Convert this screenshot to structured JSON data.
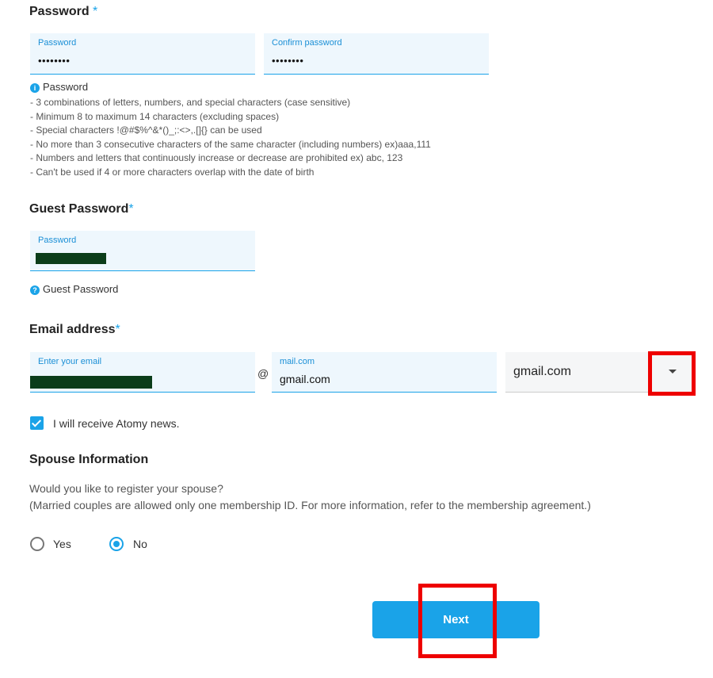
{
  "password_section": {
    "title": "Password",
    "required_mark": "*",
    "password_label": "Password",
    "password_value": "••••••••",
    "confirm_label": "Confirm password",
    "confirm_value": "••••••••",
    "info_title": "Password",
    "rules": [
      "- 3 combinations of letters, numbers, and special characters (case sensitive)",
      "- Minimum 8 to maximum 14 characters (excluding spaces)",
      "- Special characters !@#$%^&*()_;:<>,.[]{} can be used",
      "- No more than 3 consecutive characters of the same character (including numbers) ex)aaa,111",
      "- Numbers and letters that continuously increase or decrease are prohibited ex) abc, 123",
      "- Can't be used if 4 or more characters overlap with the date of birth"
    ]
  },
  "guest_section": {
    "title": "Guest Password",
    "required_mark": "*",
    "password_label": "Password",
    "info_title": "Guest Password"
  },
  "email_section": {
    "title": "Email address",
    "required_mark": "*",
    "email_label": "Enter your email",
    "at_sign": "@",
    "domain_label": "mail.com",
    "domain_value": "gmail.com",
    "select_value": "gmail.com"
  },
  "news": {
    "label": "I will receive Atomy news.",
    "checked": true
  },
  "spouse_section": {
    "title": "Spouse Information",
    "question": "Would you like to register your spouse?",
    "note": "(Married couples are allowed only one membership ID. For more information, refer to the membership agreement.)",
    "options": [
      "Yes",
      "No"
    ],
    "selected": "No"
  },
  "actions": {
    "next_label": "Next"
  },
  "colors": {
    "accent": "#1aa3e8",
    "field_bg": "#eef7fd",
    "highlight": "#ee0000"
  }
}
